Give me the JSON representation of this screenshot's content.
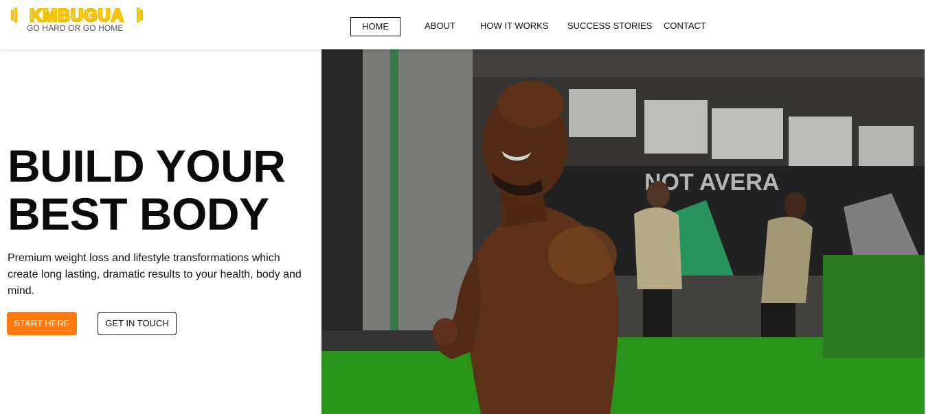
{
  "brand": {
    "logo_text": "KMBUGUA",
    "tagline": "GO HARD OR GO HOME",
    "logo_color": "#f2c200"
  },
  "nav": {
    "items": [
      {
        "label": "HOME",
        "active": true
      },
      {
        "label": "ABOUT",
        "active": false
      },
      {
        "label": "HOW IT WORKS",
        "active": false
      },
      {
        "label": "SUCCESS STORIES",
        "active": false
      },
      {
        "label": "CONTACT",
        "active": false
      }
    ]
  },
  "hero": {
    "title_line1": "BUILD YOUR",
    "title_line2": "BEST BODY",
    "subtitle": "Premium weight loss and lifestyle transformations which create long lasting, dramatic results to your health, body and mind.",
    "primary_cta": "START HERE",
    "secondary_cta": "GET IN TOUCH",
    "photo_overlay_text": "NOT AVERA"
  },
  "colors": {
    "accent": "#ff7a0f",
    "text": "#111111"
  }
}
